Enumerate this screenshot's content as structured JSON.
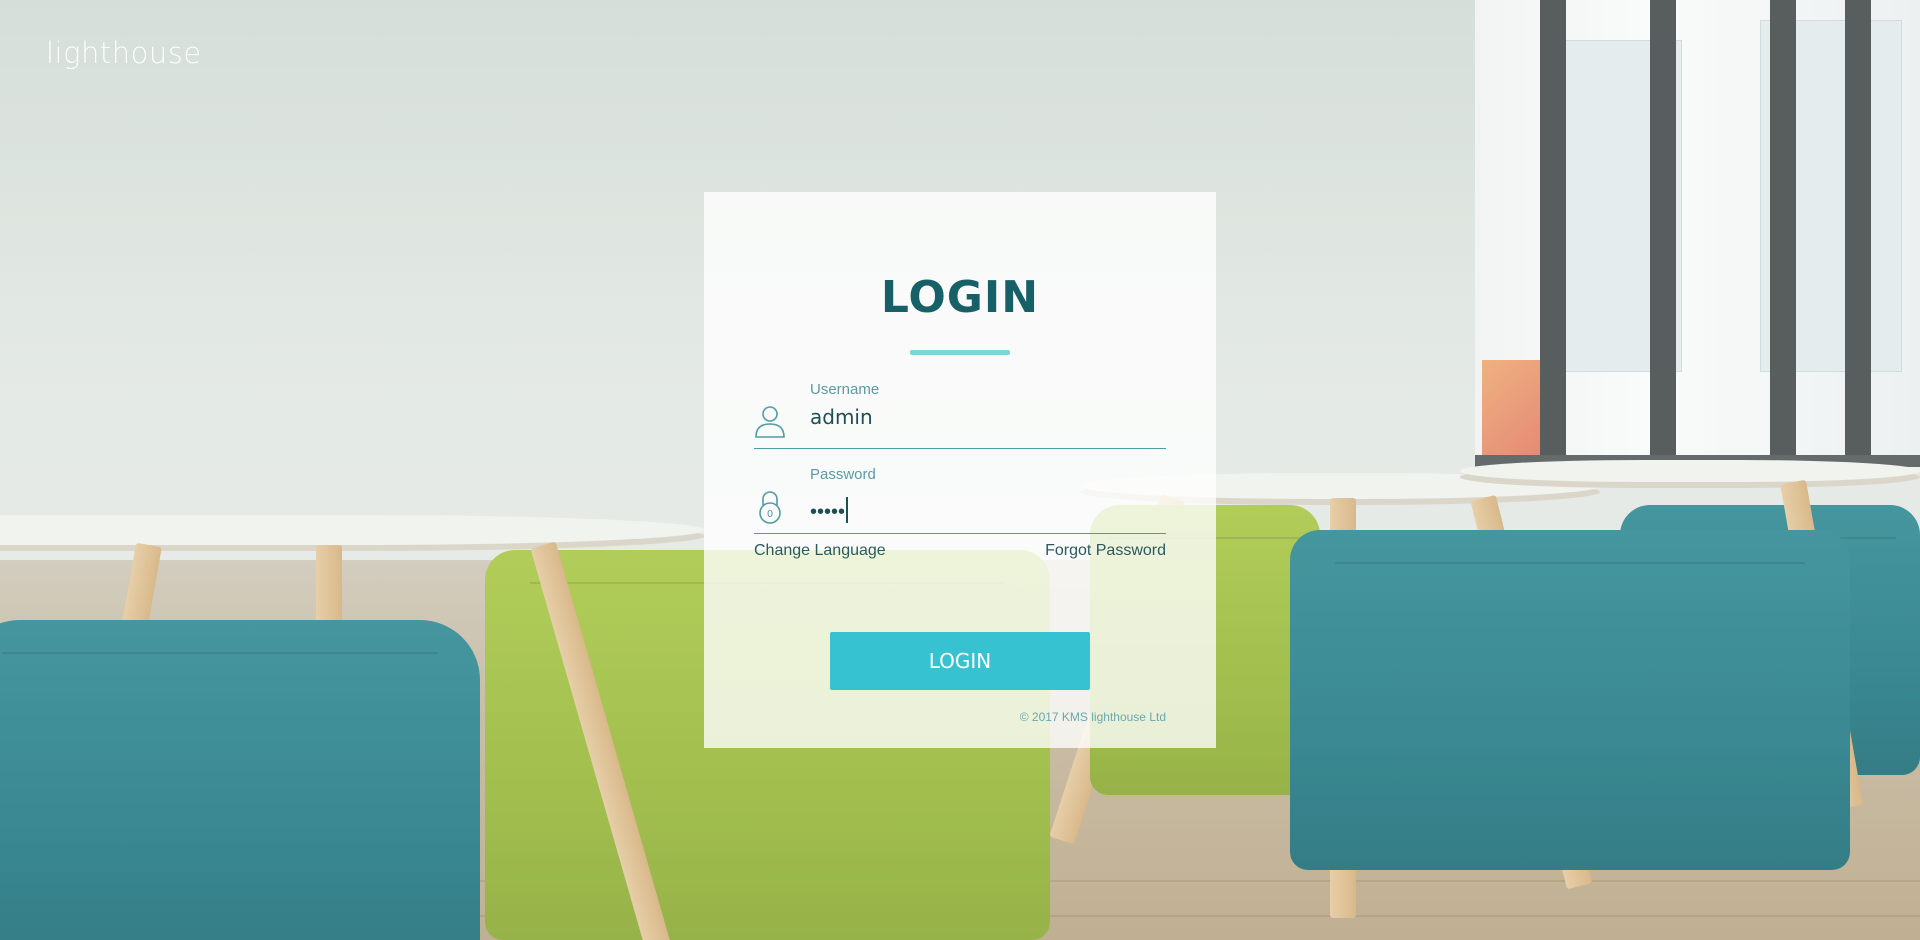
{
  "brand": {
    "logo_text": "lighthouse"
  },
  "login": {
    "title": "LOGIN",
    "username": {
      "label": "Username",
      "value": "admin"
    },
    "password": {
      "label": "Password",
      "masked_value": "•••••"
    },
    "change_language": "Change Language",
    "forgot_password": "Forgot Password",
    "submit_label": "LOGIN",
    "copyright": "© 2017 KMS lighthouse Ltd"
  },
  "icons": {
    "username": "user-icon",
    "password": "padlock-icon"
  },
  "colors": {
    "title": "#176068",
    "accent_rule": "#7fd3dc",
    "button": "#37c2d2",
    "field_line": "#4e9da4",
    "label": "#5c9aa1"
  }
}
